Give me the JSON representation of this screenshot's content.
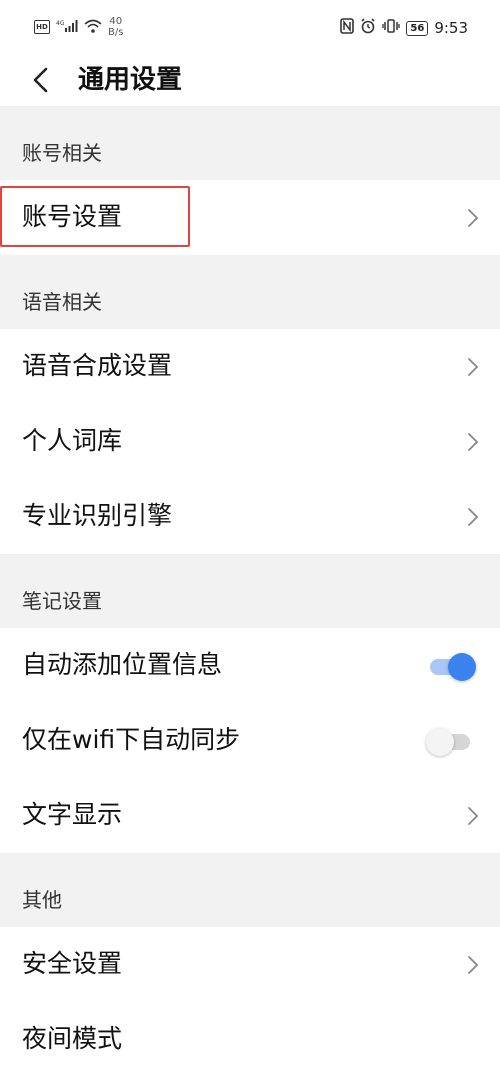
{
  "status_bar": {
    "hd_label": "HD",
    "network_label": "4G",
    "speed_value": "40",
    "speed_unit": "B/s",
    "battery": "56",
    "time": "9:53"
  },
  "header": {
    "title": "通用设置"
  },
  "sections": [
    {
      "title": "账号相关",
      "items": [
        {
          "label": "账号设置",
          "control": "chevron",
          "highlighted": true
        }
      ]
    },
    {
      "title": "语音相关",
      "items": [
        {
          "label": "语音合成设置",
          "control": "chevron"
        },
        {
          "label": "个人词库",
          "control": "chevron"
        },
        {
          "label": "专业识别引擎",
          "control": "chevron"
        }
      ]
    },
    {
      "title": "笔记设置",
      "items": [
        {
          "label": "自动添加位置信息",
          "control": "toggle",
          "toggle_on": true
        },
        {
          "label": "仅在wifi下自动同步",
          "control": "toggle",
          "toggle_on": false
        },
        {
          "label": "文字显示",
          "control": "chevron"
        }
      ]
    },
    {
      "title": "其他",
      "items": [
        {
          "label": "安全设置",
          "control": "chevron"
        },
        {
          "label": "夜间模式",
          "control": "none"
        }
      ]
    }
  ],
  "colors": {
    "toggle_on_knob": "#3b82f0",
    "toggle_on_track": "#a9c7f5",
    "highlight_border": "#e0443e",
    "section_bg": "#f2f2f2"
  },
  "icons": {
    "back": "chevron-left-icon",
    "row_arrow": "chevron-right-icon"
  }
}
